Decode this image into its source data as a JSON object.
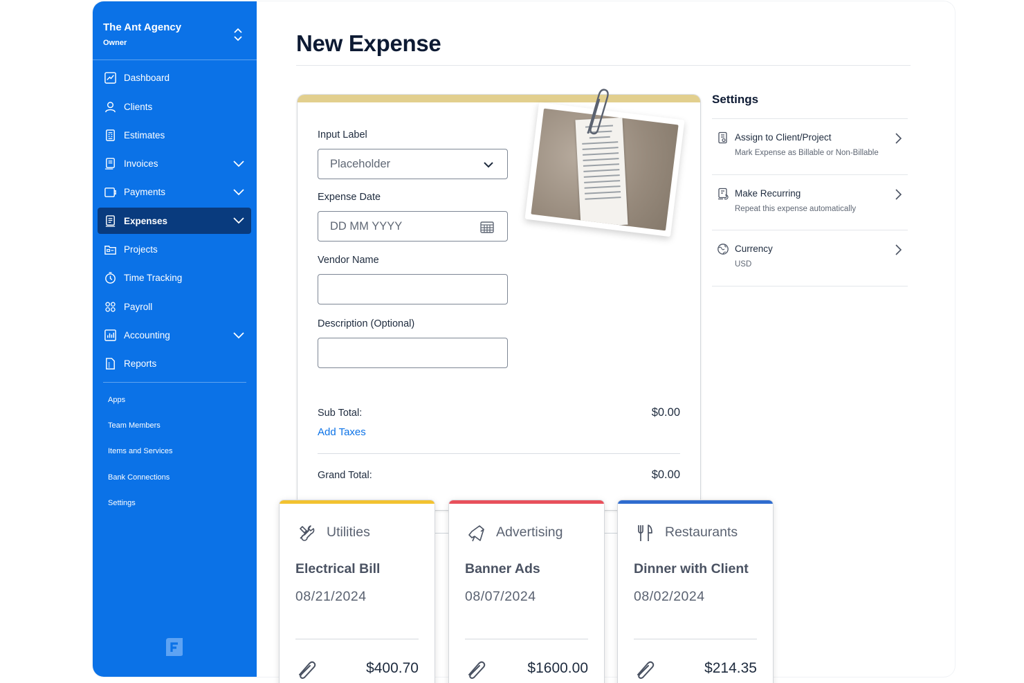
{
  "org": {
    "name": "The Ant Agency",
    "role": "Owner"
  },
  "sidebar": {
    "items": [
      {
        "label": "Dashboard",
        "icon": "dashboard-icon",
        "expandable": false,
        "active": false
      },
      {
        "label": "Clients",
        "icon": "clients-icon",
        "expandable": false,
        "active": false
      },
      {
        "label": "Estimates",
        "icon": "estimates-icon",
        "expandable": false,
        "active": false
      },
      {
        "label": "Invoices",
        "icon": "invoices-icon",
        "expandable": true,
        "active": false
      },
      {
        "label": "Payments",
        "icon": "payments-icon",
        "expandable": true,
        "active": false
      },
      {
        "label": "Expenses",
        "icon": "expenses-icon",
        "expandable": true,
        "active": true
      },
      {
        "label": "Projects",
        "icon": "projects-icon",
        "expandable": false,
        "active": false
      },
      {
        "label": "Time Tracking",
        "icon": "time-tracking-icon",
        "expandable": false,
        "active": false
      },
      {
        "label": "Payroll",
        "icon": "payroll-icon",
        "expandable": false,
        "active": false
      },
      {
        "label": "Accounting",
        "icon": "accounting-icon",
        "expandable": true,
        "active": false
      },
      {
        "label": "Reports",
        "icon": "reports-icon",
        "expandable": false,
        "active": false
      }
    ],
    "secondary": [
      "Apps",
      "Team Members",
      "Items and Services",
      "Bank Connections",
      "Settings"
    ]
  },
  "page": {
    "title": "New Expense"
  },
  "form": {
    "input_label": "Input Label",
    "input_placeholder": "Placeholder",
    "date_label": "Expense Date",
    "date_placeholder": "DD MM YYYY",
    "vendor_label": "Vendor Name",
    "vendor_value": "",
    "description_label": "Description (Optional)",
    "description_value": "",
    "subtotal_label": "Sub Total:",
    "subtotal_value": "$0.00",
    "add_taxes": "Add Taxes",
    "grand_total_label": "Grand Total:",
    "grand_total_value": "$0.00"
  },
  "settings": {
    "title": "Settings",
    "rows": [
      {
        "title": "Assign to Client/Project",
        "subtitle": "Mark Expense as Billable or Non-Billable",
        "icon": "assign-icon"
      },
      {
        "title": "Make Recurring",
        "subtitle": "Repeat this expense automatically",
        "icon": "recurring-icon"
      },
      {
        "title": "Currency",
        "subtitle": "USD",
        "icon": "currency-icon"
      }
    ]
  },
  "expense_cards": [
    {
      "category": "Utilities",
      "name": "Electrical Bill",
      "date": "08/21/2024",
      "amount": "$400.70",
      "color": "#f2c230",
      "icon": "tools-icon"
    },
    {
      "category": "Advertising",
      "name": "Banner Ads",
      "date": "08/07/2024",
      "amount": "$1600.00",
      "color": "#e8505b",
      "icon": "megaphone-icon"
    },
    {
      "category": "Restaurants",
      "name": "Dinner with Client",
      "date": "08/02/2024",
      "amount": "$214.35",
      "color": "#2f6ccf",
      "icon": "fork-knife-icon"
    }
  ],
  "colors": {
    "sidebar": "#0b72e7",
    "active_nav": "#093b7e",
    "link": "#0b72e7",
    "card_accent": "#e2cf8e"
  }
}
